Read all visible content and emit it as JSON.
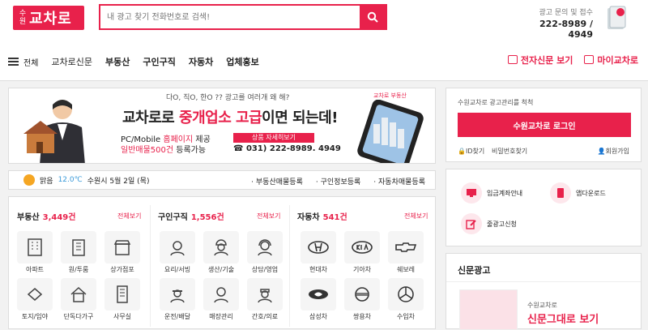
{
  "header": {
    "logo_small": "수원",
    "logo_big": "교차로",
    "search_placeholder": "내 광고 찾기 전화번호로 검색!",
    "ad_label": "광고 문의 및 접수",
    "ad_phone": "222-8989 / 4949"
  },
  "nav": {
    "all": "전체",
    "items": [
      "교차로신문",
      "부동산",
      "구인구직",
      "자동차",
      "업체홍보"
    ],
    "ebook": "전자신문 보기",
    "my": "마이교차로"
  },
  "banner": {
    "question": "다O, 직O, 한O ?? 광고를 여러개 왜 해?",
    "main_a": "교차로로 ",
    "main_b": "중개업소 고급",
    "main_c": "이면 되는데!",
    "sub1_a": "PC/Mobile ",
    "sub1_b": "홈페이지",
    "sub1_c": " 제공",
    "sub2_a": "일반매물500건",
    "sub2_b": " 등록가능",
    "detail": "상품 자세히보기",
    "tel": "☎ 031) 222-8989. 4949",
    "brand": "교차로 부동산"
  },
  "weather": {
    "status": "맑음",
    "temp": "12.0℃",
    "date": "수원시 5월 2일 (목)",
    "links": [
      "부동산매물등록",
      "구인정보등록",
      "자동차매물등록"
    ]
  },
  "sections": [
    {
      "title": "부동산",
      "count": "3,449건",
      "more": "전체보기",
      "items": [
        "아파트",
        "원/투룸",
        "상가점포",
        "토지/임야",
        "단독다가구",
        "사무실"
      ]
    },
    {
      "title": "구인구직",
      "count": "1,556건",
      "more": "전체보기",
      "items": [
        "요리/서빙",
        "생산/기술",
        "상담/영업",
        "운전/배달",
        "매장관리",
        "간호/의료"
      ]
    },
    {
      "title": "자동차",
      "count": "541건",
      "more": "전체보기",
      "items": [
        "현대차",
        "기아차",
        "쉐보레",
        "삼성차",
        "쌍용차",
        "수입차"
      ]
    }
  ],
  "login": {
    "text": "수원교차로 광고관리를 척척",
    "button": "수원교차로 로그인",
    "find_id": "ID찾기",
    "find_pw": "비밀번호찾기",
    "join": "회원가입"
  },
  "services": [
    "입금계좌안내",
    "앱다운로드",
    "줄광고신청"
  ],
  "news": {
    "title": "신문광고",
    "small": "수원교차로",
    "big": "신문그대로 보기"
  },
  "colors": {
    "accent": "#e8214b"
  }
}
